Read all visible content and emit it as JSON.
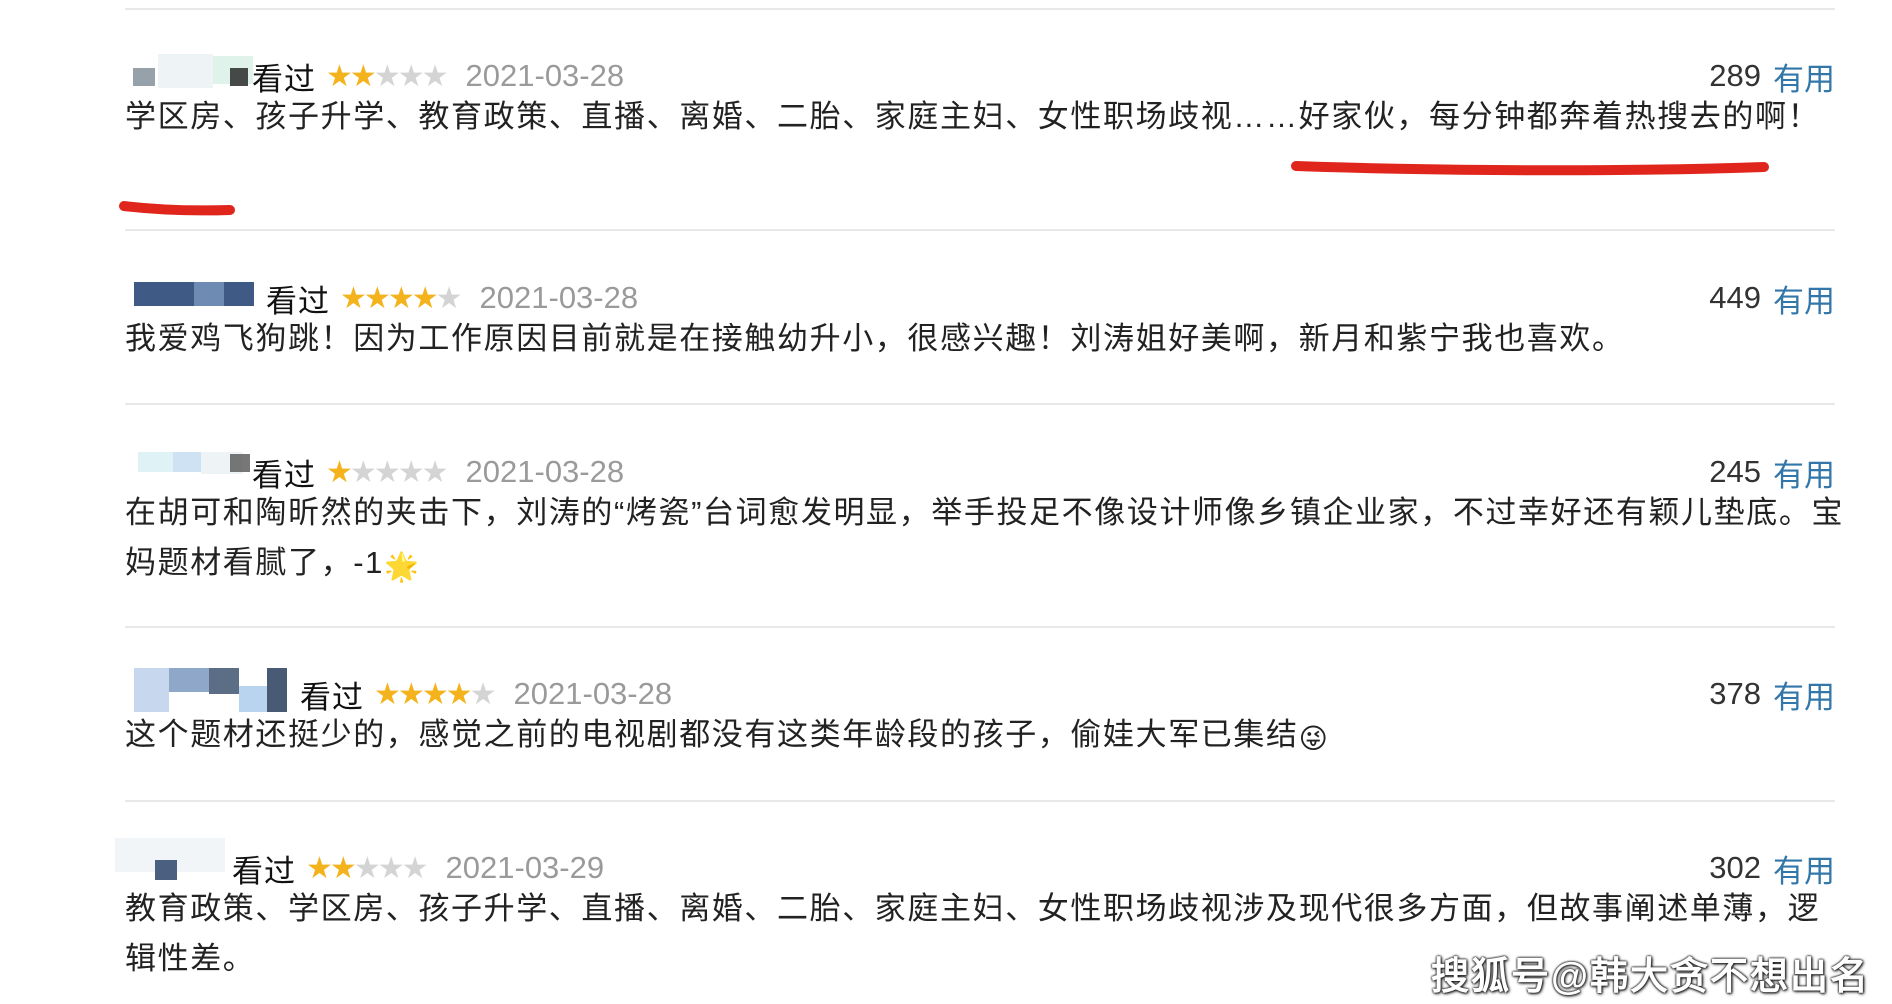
{
  "reviews": [
    {
      "watched": "看过",
      "rating": 2,
      "date": "2021-03-28",
      "votes": "289",
      "useful": "有用",
      "text": "学区房、孩子升学、教育政策、直播、离婚、二胎、家庭主妇、女性职场歧视……好家伙，每分钟都奔着热搜去的啊！"
    },
    {
      "watched": "看过",
      "rating": 4,
      "date": "2021-03-28",
      "votes": "449",
      "useful": "有用",
      "text": "我爱鸡飞狗跳！因为工作原因目前就是在接触幼升小，很感兴趣！刘涛姐好美啊，新月和紫宁我也喜欢。"
    },
    {
      "watched": "看过",
      "rating": 1,
      "date": "2021-03-28",
      "votes": "245",
      "useful": "有用",
      "text": "在胡可和陶昕然的夹击下，刘涛的“烤瓷”台词愈发明显，举手投足不像设计师像乡镇企业家，不过幸好还有颖儿垫底。宝妈题材看腻了，-1",
      "emoji": "🌟"
    },
    {
      "watched": "看过",
      "rating": 4,
      "date": "2021-03-28",
      "votes": "378",
      "useful": "有用",
      "text": "这个题材还挺少的，感觉之前的电视剧都没有这类年龄段的孩子，偷娃大军已集结",
      "emoji": "😜"
    },
    {
      "watched": "看过",
      "rating": 2,
      "date": "2021-03-29",
      "votes": "302",
      "useful": "有用",
      "text": "教育政策、学区房、孩子升学、直播、离婚、二胎、家庭主妇、女性职场歧视涉及现代很多方面，但故事阐述单薄，逻辑性差。"
    }
  ],
  "watermark": "搜狐号@韩大贪不想出名",
  "colors": {
    "star_on": "#f4b31d",
    "star_off": "#d4d4d4",
    "useful_link": "#3377aa",
    "date": "#9a9a9a",
    "underline": "#e0261c"
  }
}
